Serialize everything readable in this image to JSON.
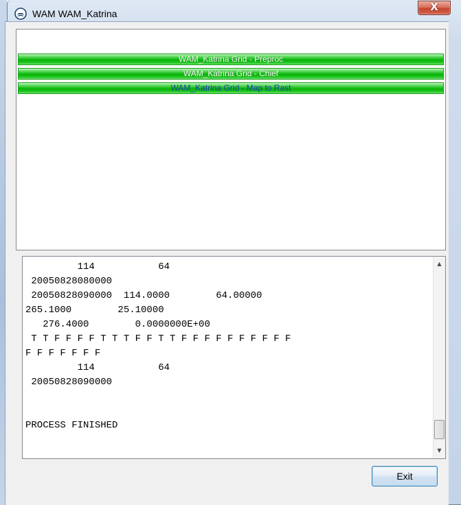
{
  "window": {
    "title": "WAM WAM_Katrina",
    "close_glyph": "X",
    "app_icon": "app-logo-icon"
  },
  "processes": [
    {
      "label": "WAM_Katrina Grid - Preproc",
      "state": "done"
    },
    {
      "label": "WAM_Katrina Grid - Chief",
      "state": "done"
    },
    {
      "label": "WAM_Katrina Grid - Map to Rast",
      "state": "active"
    }
  ],
  "log": {
    "text": "         114           64\n 20050828080000\n 20050828090000  114.0000        64.00000\n265.1000        25.10000\n   276.4000        0.0000000E+00\n T T F F F F T T T F F T T F F F F F F F F F F\nF F F F F F F\n         114           64\n 20050828090000\n\n\nPROCESS FINISHED"
  },
  "buttons": {
    "exit_label": "Exit"
  },
  "colors": {
    "progress_green": "#09b409",
    "active_text": "#1b3fae",
    "close_red": "#c4452e"
  }
}
